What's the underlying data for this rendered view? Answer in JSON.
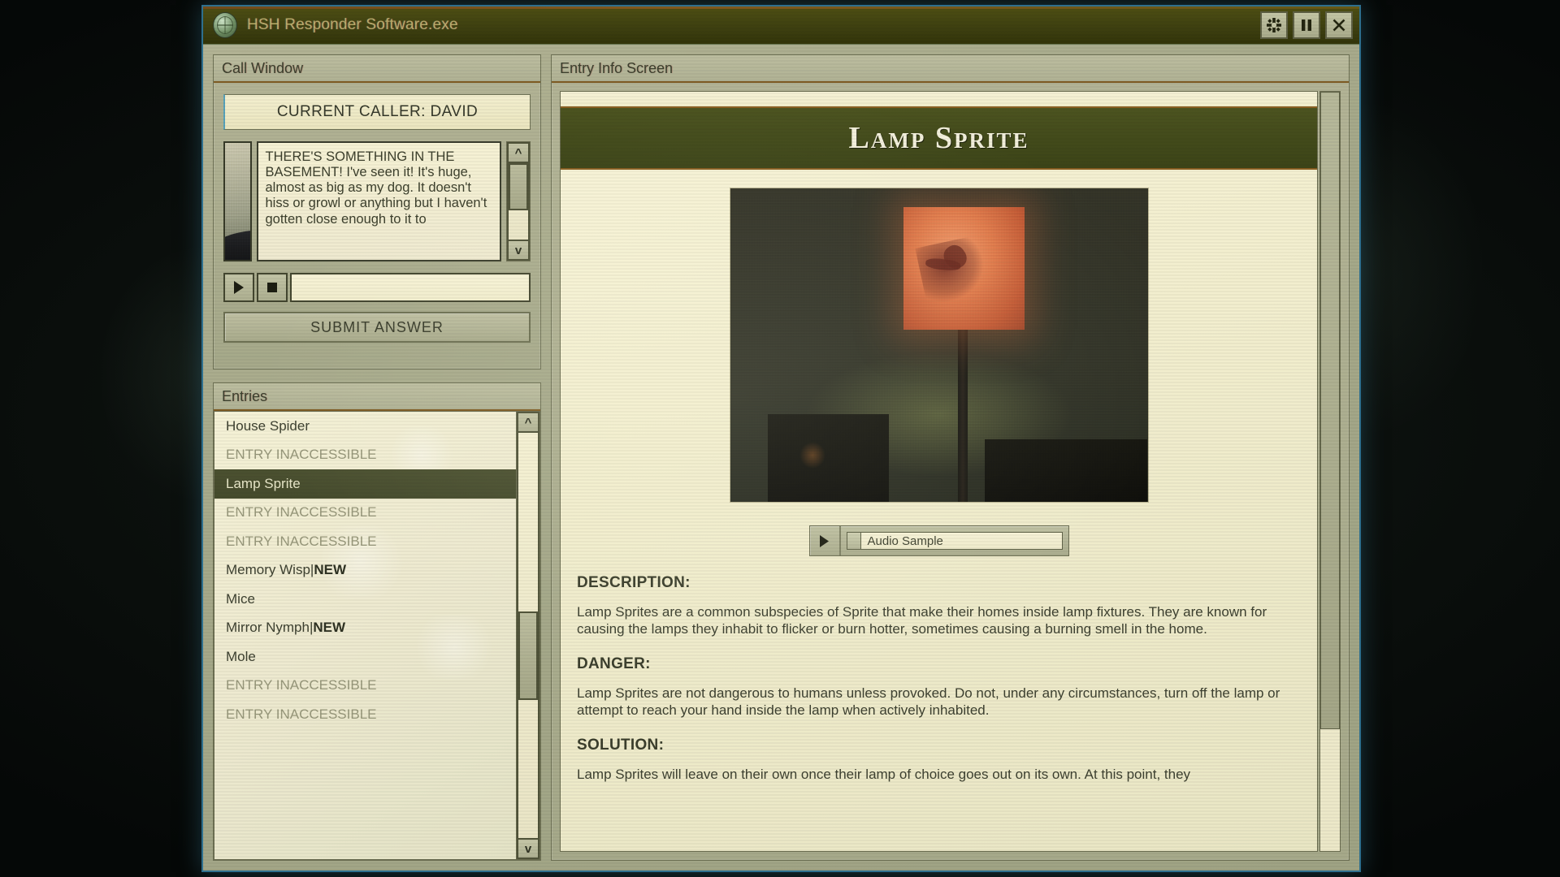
{
  "window": {
    "title": "HSH Responder Software.exe",
    "app_icon": "globe-icon",
    "buttons": [
      {
        "name": "settings",
        "icon": "gear-icon"
      },
      {
        "name": "pause",
        "icon": "pause-icon"
      },
      {
        "name": "close",
        "icon": "close-icon"
      }
    ]
  },
  "call_window": {
    "header": "Call Window",
    "caller_banner": "CURRENT CALLER: DAVID",
    "portrait_alt": "caller-portrait",
    "dialogue": "THERE'S SOMETHING IN THE BASEMENT! I've seen it! It's huge, almost as big as my dog. It doesn't hiss or growl or anything but I haven't gotten close enough to it to",
    "play_label": "▶",
    "stop_label": "■",
    "answer_value": "",
    "answer_placeholder": "",
    "submit_label": "SUBMIT ANSWER",
    "scroll_up": "^",
    "scroll_down": "v"
  },
  "entries": {
    "header": "Entries",
    "scroll_up": "^",
    "scroll_down": "v",
    "items": [
      {
        "label": "House Spider",
        "state": "normal"
      },
      {
        "label": "ENTRY INACCESSIBLE",
        "state": "inaccessible"
      },
      {
        "label": "Lamp Sprite",
        "state": "selected"
      },
      {
        "label": "ENTRY INACCESSIBLE",
        "state": "inaccessible"
      },
      {
        "label": "ENTRY INACCESSIBLE",
        "state": "inaccessible"
      },
      {
        "label": "Memory Wisp",
        "state": "normal",
        "tag": "NEW"
      },
      {
        "label": "Mice",
        "state": "normal"
      },
      {
        "label": "Mirror Nymph",
        "state": "normal",
        "tag": "NEW"
      },
      {
        "label": "Mole",
        "state": "normal"
      },
      {
        "label": "ENTRY INACCESSIBLE",
        "state": "inaccessible"
      },
      {
        "label": "ENTRY INACCESSIBLE",
        "state": "inaccessible"
      }
    ]
  },
  "entry_info": {
    "header": "Entry Info Screen",
    "title": "Lamp Sprite",
    "photo_alt": "lamp-sprite-specimen-photo",
    "audio": {
      "play_label": "▶",
      "sample_label": "Audio Sample"
    },
    "sections": [
      {
        "heading": "DESCRIPTION:",
        "body": "Lamp Sprites are a common subspecies of Sprite that make their homes inside lamp fixtures. They are known for causing the lamps they inhabit to flicker or burn hotter, sometimes causing a burning smell in the home."
      },
      {
        "heading": "DANGER:",
        "body": "Lamp Sprites are not dangerous to humans unless provoked. Do not, under any circumstances, turn off the lamp or attempt to reach your hand inside the lamp when actively inhabited."
      },
      {
        "heading": "SOLUTION:",
        "body": "Lamp Sprites will leave on their own once their lamp of choice goes out on its own. At this point, they"
      }
    ]
  },
  "colors": {
    "titlebar": "#3d3f10",
    "titlebar_text": "#bcae6a",
    "panel": "#a6a98a",
    "panel_light": "#f2eece",
    "selected_row": "#454b2c",
    "entry_banner": "#434b1b",
    "accent_orange": "#8a5f22",
    "window_border": "#2e6f8e"
  }
}
